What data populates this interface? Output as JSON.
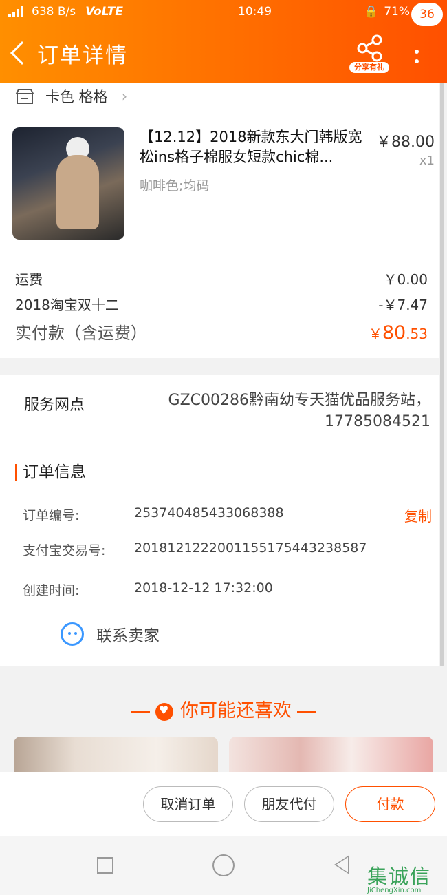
{
  "status_bar": {
    "network": "638 B/s",
    "volte": "VoLTE",
    "time": "10:49",
    "battery": "71%",
    "battery_level": 0.71
  },
  "header": {
    "title": "订单详情",
    "share_label": "分享有礼",
    "badge_count": "36"
  },
  "shop": {
    "name": "卡色 格格"
  },
  "product": {
    "title": "【12.12】2018新款东大门韩版宽松ins格子棉服女短款chic棉...",
    "spec": "咖啡色;均码",
    "price": "￥88.00",
    "qty": "x1"
  },
  "fees": {
    "shipping_label": "运费",
    "shipping_value": "￥0.00",
    "discount_label": "2018淘宝双十二",
    "discount_value": "-￥7.47",
    "total_label": "实付款（含运费）",
    "total_currency": "￥",
    "total_int": "80",
    "total_dec": ".53"
  },
  "service": {
    "label": "服务网点",
    "value": "GZC00286黔南幼专天猫优品服务站，17785084521"
  },
  "order_info": {
    "section_title": "订单信息",
    "order_no_label": "订单编号:",
    "order_no_value": "253740485433068388",
    "copy_label": "复制",
    "alipay_label": "支付宝交易号:",
    "alipay_value": "2018121222001155175443238587",
    "created_label": "创建时间:",
    "created_value": "2018-12-12 17:32:00"
  },
  "contact": {
    "label": "联系卖家"
  },
  "recommend": {
    "title": "你可能还喜欢"
  },
  "actions": {
    "cancel": "取消订单",
    "friend_pay": "朋友代付",
    "pay": "付款"
  },
  "watermark": {
    "logo": "集诚信",
    "site": "JiChengXin.com"
  },
  "colors": {
    "accent": "#ff5000",
    "header_start": "#ff8f00",
    "contact_icon": "#3a97ff"
  }
}
